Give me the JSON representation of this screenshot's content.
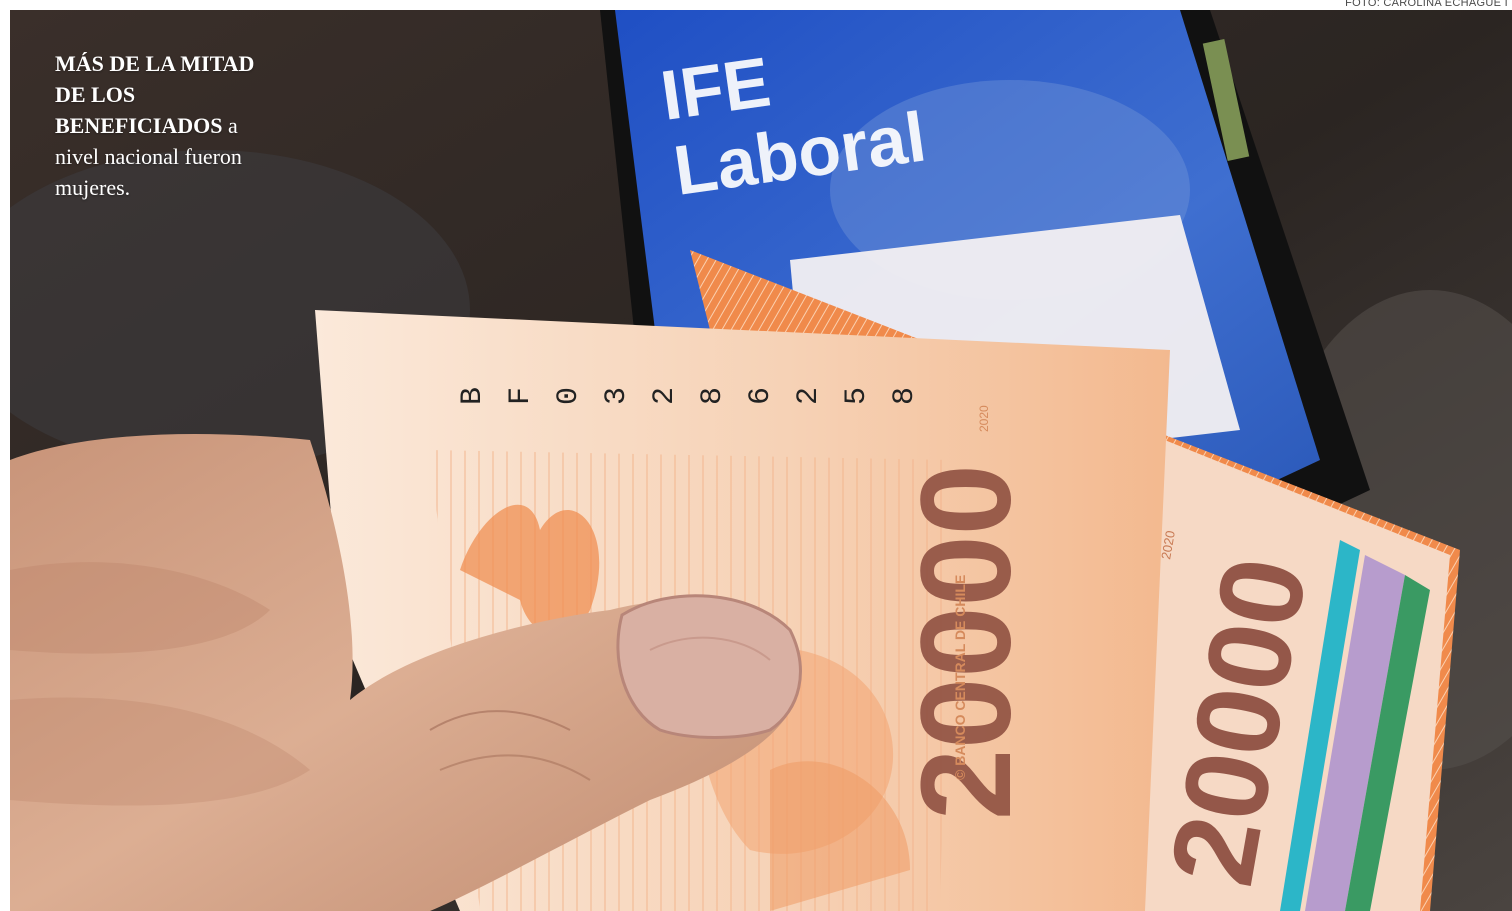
{
  "photo_credit": "FOTO: CAROLINA ECHAGÜE I",
  "caption": {
    "bold": "MÁS DE LA MITAD DE LOS BENEFICIADOS",
    "rest": " a nivel nacional fueron mujeres."
  },
  "phone_screen": {
    "line1": "IFE",
    "line2": "Laboral"
  },
  "banknote_front": {
    "serial_chars": [
      "B",
      "F",
      "0",
      "3",
      "2",
      "8",
      "6",
      "2",
      "5",
      "8"
    ],
    "denomination": "20000",
    "issuer": "© BANCO CENTRAL DE CHILE",
    "year": "2020"
  },
  "banknote_back": {
    "denomination": "20000",
    "year": "2020"
  },
  "colors": {
    "note_orange": "#f08a4b",
    "note_cream": "#fbe7d6",
    "denomination_brown": "#8a4a3c",
    "phone_blue": "#2a5bbf",
    "table_dark": "#2f2a26",
    "skin": "#d8a98f",
    "teal_stripe": "#2cb6c8",
    "lilac_stripe": "#b79ccd"
  }
}
